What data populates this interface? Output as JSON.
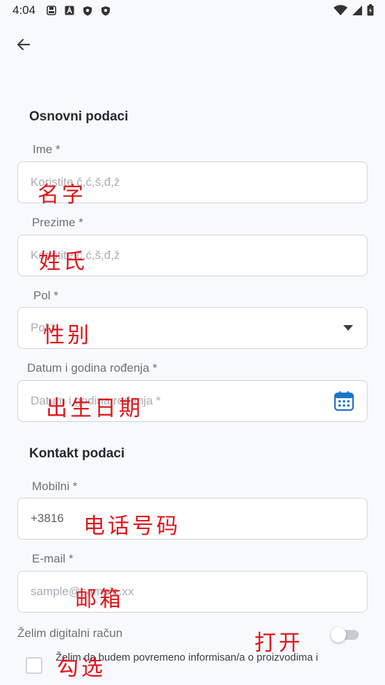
{
  "status_bar": {
    "time": "4:04"
  },
  "sections": {
    "basic": "Osnovni podaci",
    "contact": "Kontakt podaci"
  },
  "fields": {
    "first_name": {
      "label": "Ime *",
      "placeholder": "Koristite č,ć,š,đ,ž",
      "annotation": "名字"
    },
    "last_name": {
      "label": "Prezime *",
      "placeholder": "Koristite č,ć,š,đ,ž",
      "annotation": "姓氏"
    },
    "gender": {
      "label": "Pol *",
      "placeholder": "Pol *",
      "annotation": "性别"
    },
    "birth_date": {
      "label": "Datum i godina rođenja *",
      "placeholder": "Datum i godina rođenja *",
      "annotation": "出生日期"
    },
    "mobile": {
      "label": "Mobilni *",
      "value": "+3816",
      "annotation": "电话号码"
    },
    "email": {
      "label": "E-mail *",
      "placeholder": "sample@sample.xx",
      "annotation": "邮箱"
    }
  },
  "digital_account": {
    "label": "Želim digitalni račun",
    "checked": false,
    "annotation": "打开"
  },
  "newsletter": {
    "label": "Želim da budem povremeno informisan/a o proizvodima i",
    "checked": false,
    "annotation": "勾选"
  },
  "colors": {
    "background": "#f7f9fc",
    "annotation": "#e0161b",
    "calendar": "#1e73c8"
  }
}
